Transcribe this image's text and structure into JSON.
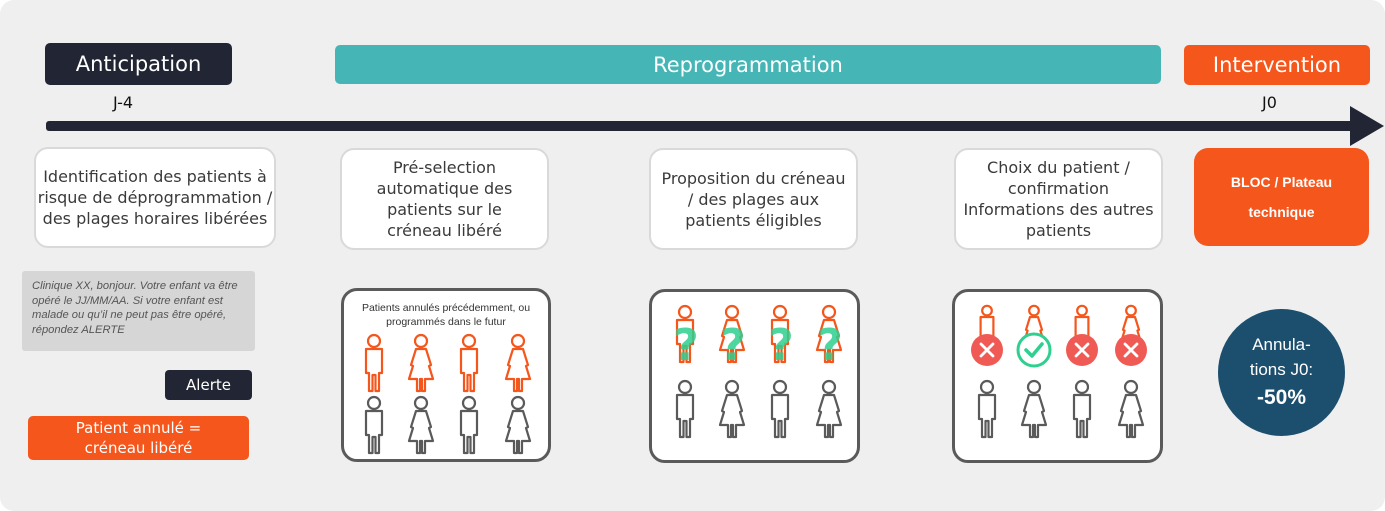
{
  "phases": {
    "anticipation": "Anticipation",
    "reprogrammation": "Reprogrammation",
    "intervention": "Intervention"
  },
  "timeline": {
    "start_label": "J-4",
    "end_label": "J0",
    "arrow_icon": "arrow-right"
  },
  "steps": [
    {
      "label": "Identification des patients à risque de déprogrammation / des plages horaires libérées"
    },
    {
      "label": "Pré-selection automatique des patients sur le créneau libéré"
    },
    {
      "label": "Proposition du créneau / des plages aux patients éligibles"
    },
    {
      "label": "Choix du patient / confirmation Informations des autres patients"
    },
    {
      "label": "BLOC / Plateau technique"
    }
  ],
  "anticipation_details": {
    "sms_text": "Clinique XX, bonjour. Votre enfant va être opéré le JJ/MM/AA. Si votre enfant est malade ou qu’il ne peut pas être opéré, répondez ALERTE",
    "alert_badge": "Alerte",
    "result_box": "Patient annulé = créneau libéré"
  },
  "panels": {
    "preselection_caption": "Patients annulés précédemment, ou programmés dans le futur",
    "proposition_icon": "question-mark",
    "choice_icons": [
      "cross",
      "check",
      "cross",
      "cross"
    ]
  },
  "stat": {
    "label_line1": "Annula-",
    "label_line2": "tions J0:",
    "value": "-50%"
  },
  "colors": {
    "dark": "#222634",
    "teal": "#45b5b6",
    "orange": "#f5561c",
    "green": "#2fcf8f",
    "red": "#f05a55",
    "navy": "#1c4f6e"
  }
}
